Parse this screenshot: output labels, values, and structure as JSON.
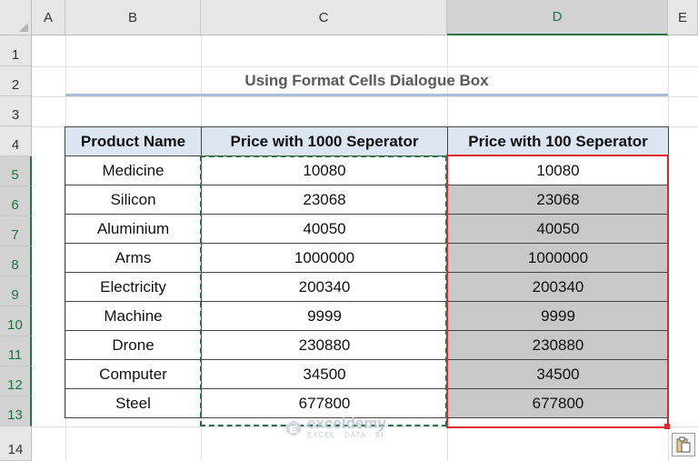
{
  "columns": [
    "A",
    "B",
    "C",
    "D",
    "E"
  ],
  "rows": [
    "1",
    "2",
    "3",
    "4",
    "5",
    "6",
    "7",
    "8",
    "9",
    "10",
    "11",
    "12",
    "13",
    "14"
  ],
  "title": "Using Format Cells Dialogue Box",
  "table": {
    "headers": [
      "Product Name",
      "Price with 1000 Seperator",
      "Price with 100 Seperator"
    ],
    "rows": [
      [
        "Medicine",
        "10080",
        "10080"
      ],
      [
        "Silicon",
        "23068",
        "23068"
      ],
      [
        "Aluminium",
        "40050",
        "40050"
      ],
      [
        "Arms",
        "1000000",
        "1000000"
      ],
      [
        "Electricity",
        "200340",
        "200340"
      ],
      [
        "Machine",
        "9999",
        "9999"
      ],
      [
        "Drone",
        "230880",
        "230880"
      ],
      [
        "Computer",
        "34500",
        "34500"
      ],
      [
        "Steel",
        "677800",
        "677800"
      ]
    ]
  },
  "watermark": {
    "name": "exceldemy",
    "tagline": "EXCEL · DATA · BI"
  },
  "icons": {
    "select_all": "select-all-triangle-icon",
    "paste": "paste-options-icon",
    "logo": "exceldemy-logo-icon"
  },
  "colors": {
    "header_fill": "#dce6f2",
    "selected_fill": "#c8c8c8",
    "selection_border": "#e0272d",
    "copy_border": "#217346"
  }
}
